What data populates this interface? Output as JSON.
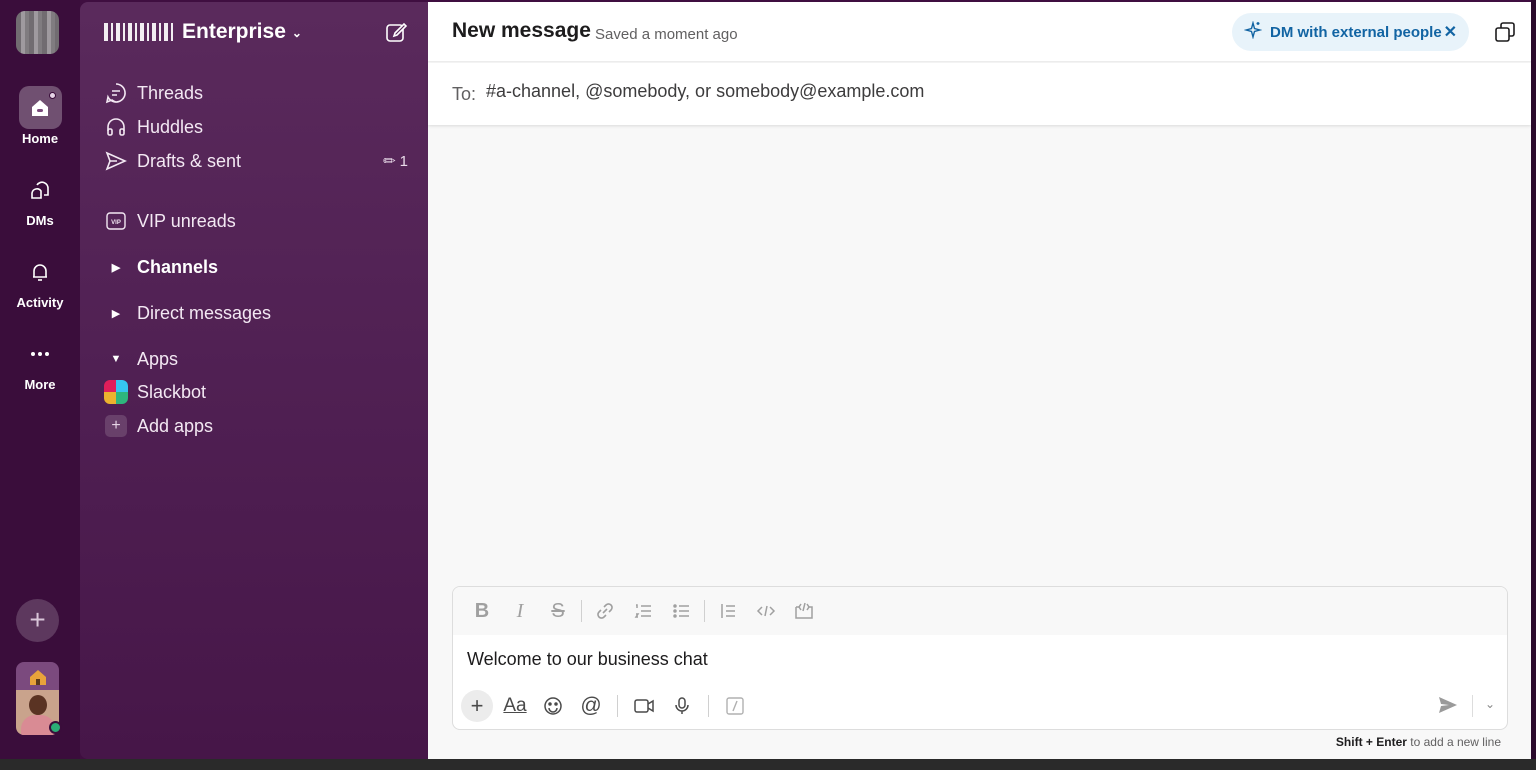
{
  "rail": {
    "items": [
      {
        "label": "Home"
      },
      {
        "label": "DMs"
      },
      {
        "label": "Activity"
      },
      {
        "label": "More"
      }
    ],
    "add_icon": "plus-icon"
  },
  "sidebar": {
    "workspace_name": "Enterprise",
    "nav": [
      {
        "label": "Threads",
        "icon": "threads-icon"
      },
      {
        "label": "Huddles",
        "icon": "headphones-icon"
      },
      {
        "label": "Drafts & sent",
        "icon": "send-icon",
        "count": "1"
      },
      {
        "label": "VIP unreads",
        "icon": "vip-icon"
      }
    ],
    "sections": [
      {
        "label": "Channels",
        "expanded": false
      },
      {
        "label": "Direct messages",
        "expanded": false
      },
      {
        "label": "Apps",
        "expanded": true
      }
    ],
    "apps": [
      {
        "label": "Slackbot"
      },
      {
        "label": "Add apps"
      }
    ]
  },
  "main": {
    "title": "New message",
    "saved_status": "Saved a moment ago",
    "external_pill": "DM with external people",
    "to_label": "To:",
    "to_placeholder": "#a-channel, @somebody, or somebody@example.com",
    "composer": {
      "text": "Welcome to our business chat",
      "hint_keys": "Shift + Enter",
      "hint_rest": " to add a new line"
    }
  },
  "colors": {
    "rail_bg": "#3a0d3b",
    "sidebar_bg": "#5a2a5c",
    "accent_blue": "#1264a3"
  }
}
